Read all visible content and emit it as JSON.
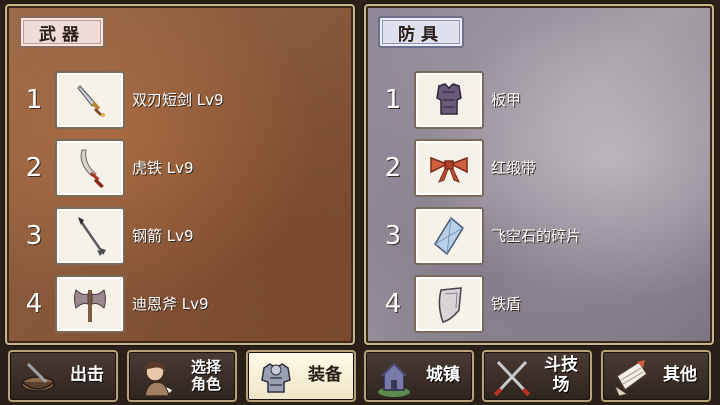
{
  "weapon_panel": {
    "tab_label": "武器",
    "items": [
      {
        "num": "1",
        "name": "双刃短剑 Lv9",
        "icon": "twin-dagger-icon"
      },
      {
        "num": "2",
        "name": "虎铁 Lv9",
        "icon": "curved-sword-icon"
      },
      {
        "num": "3",
        "name": "钢箭 Lv9",
        "icon": "arrow-icon"
      },
      {
        "num": "4",
        "name": "迪恩斧 Lv9",
        "icon": "axe-icon"
      }
    ]
  },
  "armor_panel": {
    "tab_label": "防具",
    "items": [
      {
        "num": "1",
        "name": "板甲",
        "icon": "plate-armor-icon"
      },
      {
        "num": "2",
        "name": "红缎带",
        "icon": "red-ribbon-icon"
      },
      {
        "num": "3",
        "name": "飞空石的碎片",
        "icon": "crystal-shard-icon"
      },
      {
        "num": "4",
        "name": "铁盾",
        "icon": "iron-shield-icon"
      }
    ]
  },
  "navbar": {
    "buttons": [
      {
        "label": "出击",
        "icon": "sortie-icon",
        "active": false
      },
      {
        "label": "选择\n角色",
        "icon": "character-select-icon",
        "active": false
      },
      {
        "label": "装备",
        "icon": "equipment-icon",
        "active": true
      },
      {
        "label": "城镇",
        "icon": "town-icon",
        "active": false
      },
      {
        "label": "斗技场",
        "icon": "arena-icon",
        "active": false
      },
      {
        "label": "其他",
        "icon": "other-icon",
        "active": false
      }
    ]
  },
  "colors": {
    "weapon_tab_bg": "#f0dcd6",
    "armor_tab_bg": "#dfe0ee",
    "active_button_bg": "#fffbe8",
    "button_border": "#b8a278"
  }
}
